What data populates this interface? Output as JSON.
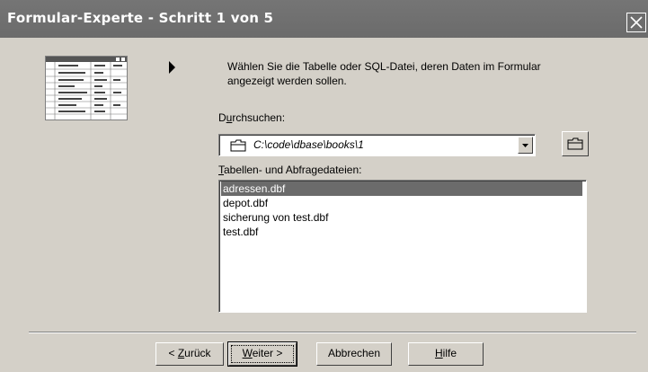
{
  "window": {
    "title": "Formular-Experte - Schritt 1 von 5",
    "close_icon": "close-icon"
  },
  "description": "Wählen Sie die Tabelle oder SQL-Datei, deren Daten im Formular angezeigt werden sollen.",
  "browse": {
    "label_prefix": "D",
    "label_accel": "u",
    "label_rest": "rchsuchen:",
    "path": "C:\\code\\dbase\\books\\1",
    "folder_icon": "folder-icon",
    "browse_icon": "open-folder-icon"
  },
  "files": {
    "label_accel": "T",
    "label_rest": "abellen- und Abfragedateien:",
    "items": [
      "adressen.dbf",
      "depot.dbf",
      "sicherung von test.dbf",
      "test.dbf"
    ],
    "selected_index": 0
  },
  "buttons": {
    "back_pre": "< ",
    "back_accel": "Z",
    "back_rest": "urück",
    "next_accel": "W",
    "next_rest": "eiter >",
    "cancel": "Abbrechen",
    "help_accel": "H",
    "help_rest": "ilfe"
  },
  "colors": {
    "titlebar": "#6b6b6b",
    "selection": "#6b6b6b",
    "face": "#d4d0c8"
  }
}
